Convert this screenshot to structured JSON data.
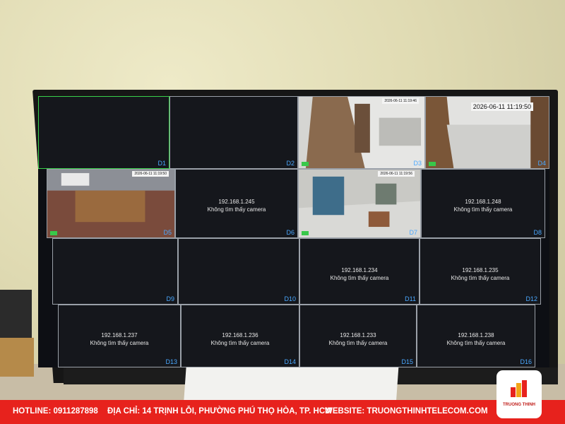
{
  "screen": {
    "timestamps": {
      "d3": "2026-06-11 11:19:46",
      "d4": "2026-06-11 11:19:50",
      "d5": "2026-06-11 11:19:50",
      "d7": "2026-06-11 11:19:56"
    },
    "cells": [
      {
        "label": "D1",
        "ip": "",
        "status": ""
      },
      {
        "label": "D2",
        "ip": "",
        "status": ""
      },
      {
        "label": "D3",
        "ip": "",
        "status": ""
      },
      {
        "label": "D4",
        "ip": "",
        "status": ""
      },
      {
        "label": "D5",
        "ip": "",
        "status": ""
      },
      {
        "label": "D6",
        "ip": "192.168.1.245",
        "status": "Không tìm thấy camera"
      },
      {
        "label": "D7",
        "ip": "",
        "status": ""
      },
      {
        "label": "D8",
        "ip": "192.168.1.248",
        "status": "Không tìm thấy camera"
      },
      {
        "label": "D9",
        "ip": "",
        "status": ""
      },
      {
        "label": "D10",
        "ip": "",
        "status": ""
      },
      {
        "label": "D11",
        "ip": "192.168.1.234",
        "status": "Không tìm thấy camera"
      },
      {
        "label": "D12",
        "ip": "192.168.1.235",
        "status": "Không tìm thấy camera"
      },
      {
        "label": "D13",
        "ip": "192.168.1.237",
        "status": "Không tìm thấy camera"
      },
      {
        "label": "D14",
        "ip": "192.168.1.236",
        "status": "Không tìm thấy camera"
      },
      {
        "label": "D15",
        "ip": "192.168.1.233",
        "status": "Không tìm thấy camera"
      },
      {
        "label": "D16",
        "ip": "192.168.1.238",
        "status": "Không tìm thấy camera"
      }
    ],
    "colors": {
      "selected_border": "#39d04a",
      "label_blue": "#4aa8ff"
    }
  },
  "footer": {
    "hotline": "HOTLINE: 0911287898",
    "address": "ĐỊA CHỈ: 14 TRỊNH LỖI, PHƯỜNG PHÚ THỌ HÒA, TP. HCM",
    "website": "WEBSITE: TRUONGTHINHTELECOM.COM",
    "brand": "TRUONG THINH",
    "color": "#e7221d"
  }
}
